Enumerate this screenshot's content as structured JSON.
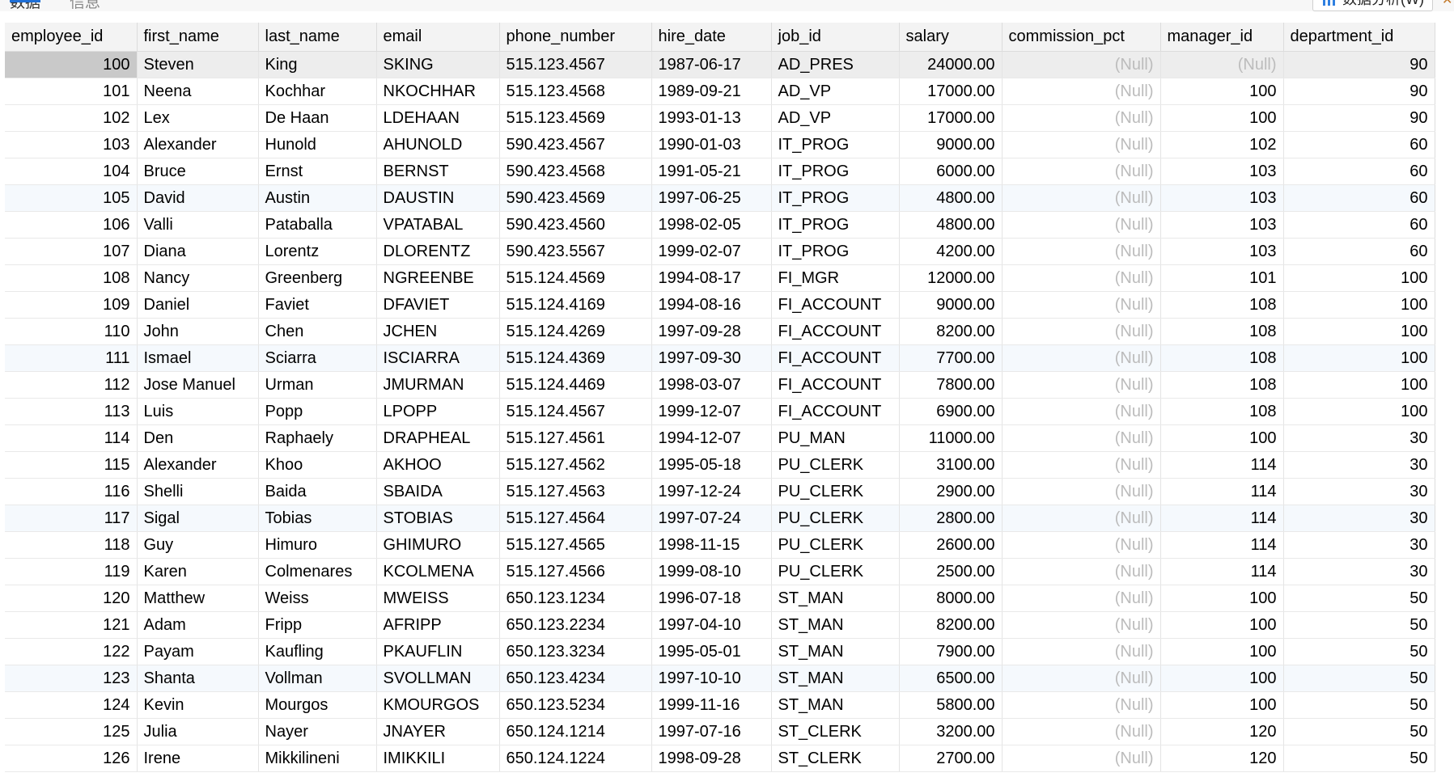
{
  "tabs": [
    {
      "label": "数据"
    },
    {
      "label": "信息"
    }
  ],
  "toolbar": {
    "analyze_label": "数据分析(W)"
  },
  "table": {
    "columns": [
      "employee_id",
      "first_name",
      "last_name",
      "email",
      "phone_number",
      "hire_date",
      "job_id",
      "salary",
      "commission_pct",
      "manager_id",
      "department_id"
    ],
    "null_text": "(Null)",
    "rows": [
      {
        "employee_id": "100",
        "first_name": "Steven",
        "last_name": "King",
        "email": "SKING",
        "phone_number": "515.123.4567",
        "hire_date": "1987-06-17",
        "job_id": "AD_PRES",
        "salary": "24000.00",
        "commission_pct": "(Null)",
        "manager_id": "(Null)",
        "department_id": "90"
      },
      {
        "employee_id": "101",
        "first_name": "Neena",
        "last_name": "Kochhar",
        "email": "NKOCHHAR",
        "phone_number": "515.123.4568",
        "hire_date": "1989-09-21",
        "job_id": "AD_VP",
        "salary": "17000.00",
        "commission_pct": "(Null)",
        "manager_id": "100",
        "department_id": "90"
      },
      {
        "employee_id": "102",
        "first_name": "Lex",
        "last_name": "De Haan",
        "email": "LDEHAAN",
        "phone_number": "515.123.4569",
        "hire_date": "1993-01-13",
        "job_id": "AD_VP",
        "salary": "17000.00",
        "commission_pct": "(Null)",
        "manager_id": "100",
        "department_id": "90"
      },
      {
        "employee_id": "103",
        "first_name": "Alexander",
        "last_name": "Hunold",
        "email": "AHUNOLD",
        "phone_number": "590.423.4567",
        "hire_date": "1990-01-03",
        "job_id": "IT_PROG",
        "salary": "9000.00",
        "commission_pct": "(Null)",
        "manager_id": "102",
        "department_id": "60"
      },
      {
        "employee_id": "104",
        "first_name": "Bruce",
        "last_name": "Ernst",
        "email": "BERNST",
        "phone_number": "590.423.4568",
        "hire_date": "1991-05-21",
        "job_id": "IT_PROG",
        "salary": "6000.00",
        "commission_pct": "(Null)",
        "manager_id": "103",
        "department_id": "60"
      },
      {
        "employee_id": "105",
        "first_name": "David",
        "last_name": "Austin",
        "email": "DAUSTIN",
        "phone_number": "590.423.4569",
        "hire_date": "1997-06-25",
        "job_id": "IT_PROG",
        "salary": "4800.00",
        "commission_pct": "(Null)",
        "manager_id": "103",
        "department_id": "60"
      },
      {
        "employee_id": "106",
        "first_name": "Valli",
        "last_name": "Pataballa",
        "email": "VPATABAL",
        "phone_number": "590.423.4560",
        "hire_date": "1998-02-05",
        "job_id": "IT_PROG",
        "salary": "4800.00",
        "commission_pct": "(Null)",
        "manager_id": "103",
        "department_id": "60"
      },
      {
        "employee_id": "107",
        "first_name": "Diana",
        "last_name": "Lorentz",
        "email": "DLORENTZ",
        "phone_number": "590.423.5567",
        "hire_date": "1999-02-07",
        "job_id": "IT_PROG",
        "salary": "4200.00",
        "commission_pct": "(Null)",
        "manager_id": "103",
        "department_id": "60"
      },
      {
        "employee_id": "108",
        "first_name": "Nancy",
        "last_name": "Greenberg",
        "email": "NGREENBE",
        "phone_number": "515.124.4569",
        "hire_date": "1994-08-17",
        "job_id": "FI_MGR",
        "salary": "12000.00",
        "commission_pct": "(Null)",
        "manager_id": "101",
        "department_id": "100"
      },
      {
        "employee_id": "109",
        "first_name": "Daniel",
        "last_name": "Faviet",
        "email": "DFAVIET",
        "phone_number": "515.124.4169",
        "hire_date": "1994-08-16",
        "job_id": "FI_ACCOUNT",
        "salary": "9000.00",
        "commission_pct": "(Null)",
        "manager_id": "108",
        "department_id": "100"
      },
      {
        "employee_id": "110",
        "first_name": "John",
        "last_name": "Chen",
        "email": "JCHEN",
        "phone_number": "515.124.4269",
        "hire_date": "1997-09-28",
        "job_id": "FI_ACCOUNT",
        "salary": "8200.00",
        "commission_pct": "(Null)",
        "manager_id": "108",
        "department_id": "100"
      },
      {
        "employee_id": "111",
        "first_name": "Ismael",
        "last_name": "Sciarra",
        "email": "ISCIARRA",
        "phone_number": "515.124.4369",
        "hire_date": "1997-09-30",
        "job_id": "FI_ACCOUNT",
        "salary": "7700.00",
        "commission_pct": "(Null)",
        "manager_id": "108",
        "department_id": "100"
      },
      {
        "employee_id": "112",
        "first_name": "Jose Manuel",
        "last_name": "Urman",
        "email": "JMURMAN",
        "phone_number": "515.124.4469",
        "hire_date": "1998-03-07",
        "job_id": "FI_ACCOUNT",
        "salary": "7800.00",
        "commission_pct": "(Null)",
        "manager_id": "108",
        "department_id": "100"
      },
      {
        "employee_id": "113",
        "first_name": "Luis",
        "last_name": "Popp",
        "email": "LPOPP",
        "phone_number": "515.124.4567",
        "hire_date": "1999-12-07",
        "job_id": "FI_ACCOUNT",
        "salary": "6900.00",
        "commission_pct": "(Null)",
        "manager_id": "108",
        "department_id": "100"
      },
      {
        "employee_id": "114",
        "first_name": "Den",
        "last_name": "Raphaely",
        "email": "DRAPHEAL",
        "phone_number": "515.127.4561",
        "hire_date": "1994-12-07",
        "job_id": "PU_MAN",
        "salary": "11000.00",
        "commission_pct": "(Null)",
        "manager_id": "100",
        "department_id": "30"
      },
      {
        "employee_id": "115",
        "first_name": "Alexander",
        "last_name": "Khoo",
        "email": "AKHOO",
        "phone_number": "515.127.4562",
        "hire_date": "1995-05-18",
        "job_id": "PU_CLERK",
        "salary": "3100.00",
        "commission_pct": "(Null)",
        "manager_id": "114",
        "department_id": "30"
      },
      {
        "employee_id": "116",
        "first_name": "Shelli",
        "last_name": "Baida",
        "email": "SBAIDA",
        "phone_number": "515.127.4563",
        "hire_date": "1997-12-24",
        "job_id": "PU_CLERK",
        "salary": "2900.00",
        "commission_pct": "(Null)",
        "manager_id": "114",
        "department_id": "30"
      },
      {
        "employee_id": "117",
        "first_name": "Sigal",
        "last_name": "Tobias",
        "email": "STOBIAS",
        "phone_number": "515.127.4564",
        "hire_date": "1997-07-24",
        "job_id": "PU_CLERK",
        "salary": "2800.00",
        "commission_pct": "(Null)",
        "manager_id": "114",
        "department_id": "30"
      },
      {
        "employee_id": "118",
        "first_name": "Guy",
        "last_name": "Himuro",
        "email": "GHIMURO",
        "phone_number": "515.127.4565",
        "hire_date": "1998-11-15",
        "job_id": "PU_CLERK",
        "salary": "2600.00",
        "commission_pct": "(Null)",
        "manager_id": "114",
        "department_id": "30"
      },
      {
        "employee_id": "119",
        "first_name": "Karen",
        "last_name": "Colmenares",
        "email": "KCOLMENA",
        "phone_number": "515.127.4566",
        "hire_date": "1999-08-10",
        "job_id": "PU_CLERK",
        "salary": "2500.00",
        "commission_pct": "(Null)",
        "manager_id": "114",
        "department_id": "30"
      },
      {
        "employee_id": "120",
        "first_name": "Matthew",
        "last_name": "Weiss",
        "email": "MWEISS",
        "phone_number": "650.123.1234",
        "hire_date": "1996-07-18",
        "job_id": "ST_MAN",
        "salary": "8000.00",
        "commission_pct": "(Null)",
        "manager_id": "100",
        "department_id": "50"
      },
      {
        "employee_id": "121",
        "first_name": "Adam",
        "last_name": "Fripp",
        "email": "AFRIPP",
        "phone_number": "650.123.2234",
        "hire_date": "1997-04-10",
        "job_id": "ST_MAN",
        "salary": "8200.00",
        "commission_pct": "(Null)",
        "manager_id": "100",
        "department_id": "50"
      },
      {
        "employee_id": "122",
        "first_name": "Payam",
        "last_name": "Kaufling",
        "email": "PKAUFLIN",
        "phone_number": "650.123.3234",
        "hire_date": "1995-05-01",
        "job_id": "ST_MAN",
        "salary": "7900.00",
        "commission_pct": "(Null)",
        "manager_id": "100",
        "department_id": "50"
      },
      {
        "employee_id": "123",
        "first_name": "Shanta",
        "last_name": "Vollman",
        "email": "SVOLLMAN",
        "phone_number": "650.123.4234",
        "hire_date": "1997-10-10",
        "job_id": "ST_MAN",
        "salary": "6500.00",
        "commission_pct": "(Null)",
        "manager_id": "100",
        "department_id": "50"
      },
      {
        "employee_id": "124",
        "first_name": "Kevin",
        "last_name": "Mourgos",
        "email": "KMOURGOS",
        "phone_number": "650.123.5234",
        "hire_date": "1999-11-16",
        "job_id": "ST_MAN",
        "salary": "5800.00",
        "commission_pct": "(Null)",
        "manager_id": "100",
        "department_id": "50"
      },
      {
        "employee_id": "125",
        "first_name": "Julia",
        "last_name": "Nayer",
        "email": "JNAYER",
        "phone_number": "650.124.1214",
        "hire_date": "1997-07-16",
        "job_id": "ST_CLERK",
        "salary": "3200.00",
        "commission_pct": "(Null)",
        "manager_id": "120",
        "department_id": "50"
      },
      {
        "employee_id": "126",
        "first_name": "Irene",
        "last_name": "Mikkilineni",
        "email": "IMIKKILI",
        "phone_number": "650.124.1224",
        "hire_date": "1998-09-28",
        "job_id": "ST_CLERK",
        "salary": "2700.00",
        "commission_pct": "(Null)",
        "manager_id": "120",
        "department_id": "50"
      }
    ]
  },
  "colors": {
    "selected_row": "#ededed",
    "selected_key_cell": "#c9c9c9",
    "alt_row": "#f5f9fd",
    "null_text": "#bcbcbc",
    "header_bg": "#f3f3f3"
  }
}
